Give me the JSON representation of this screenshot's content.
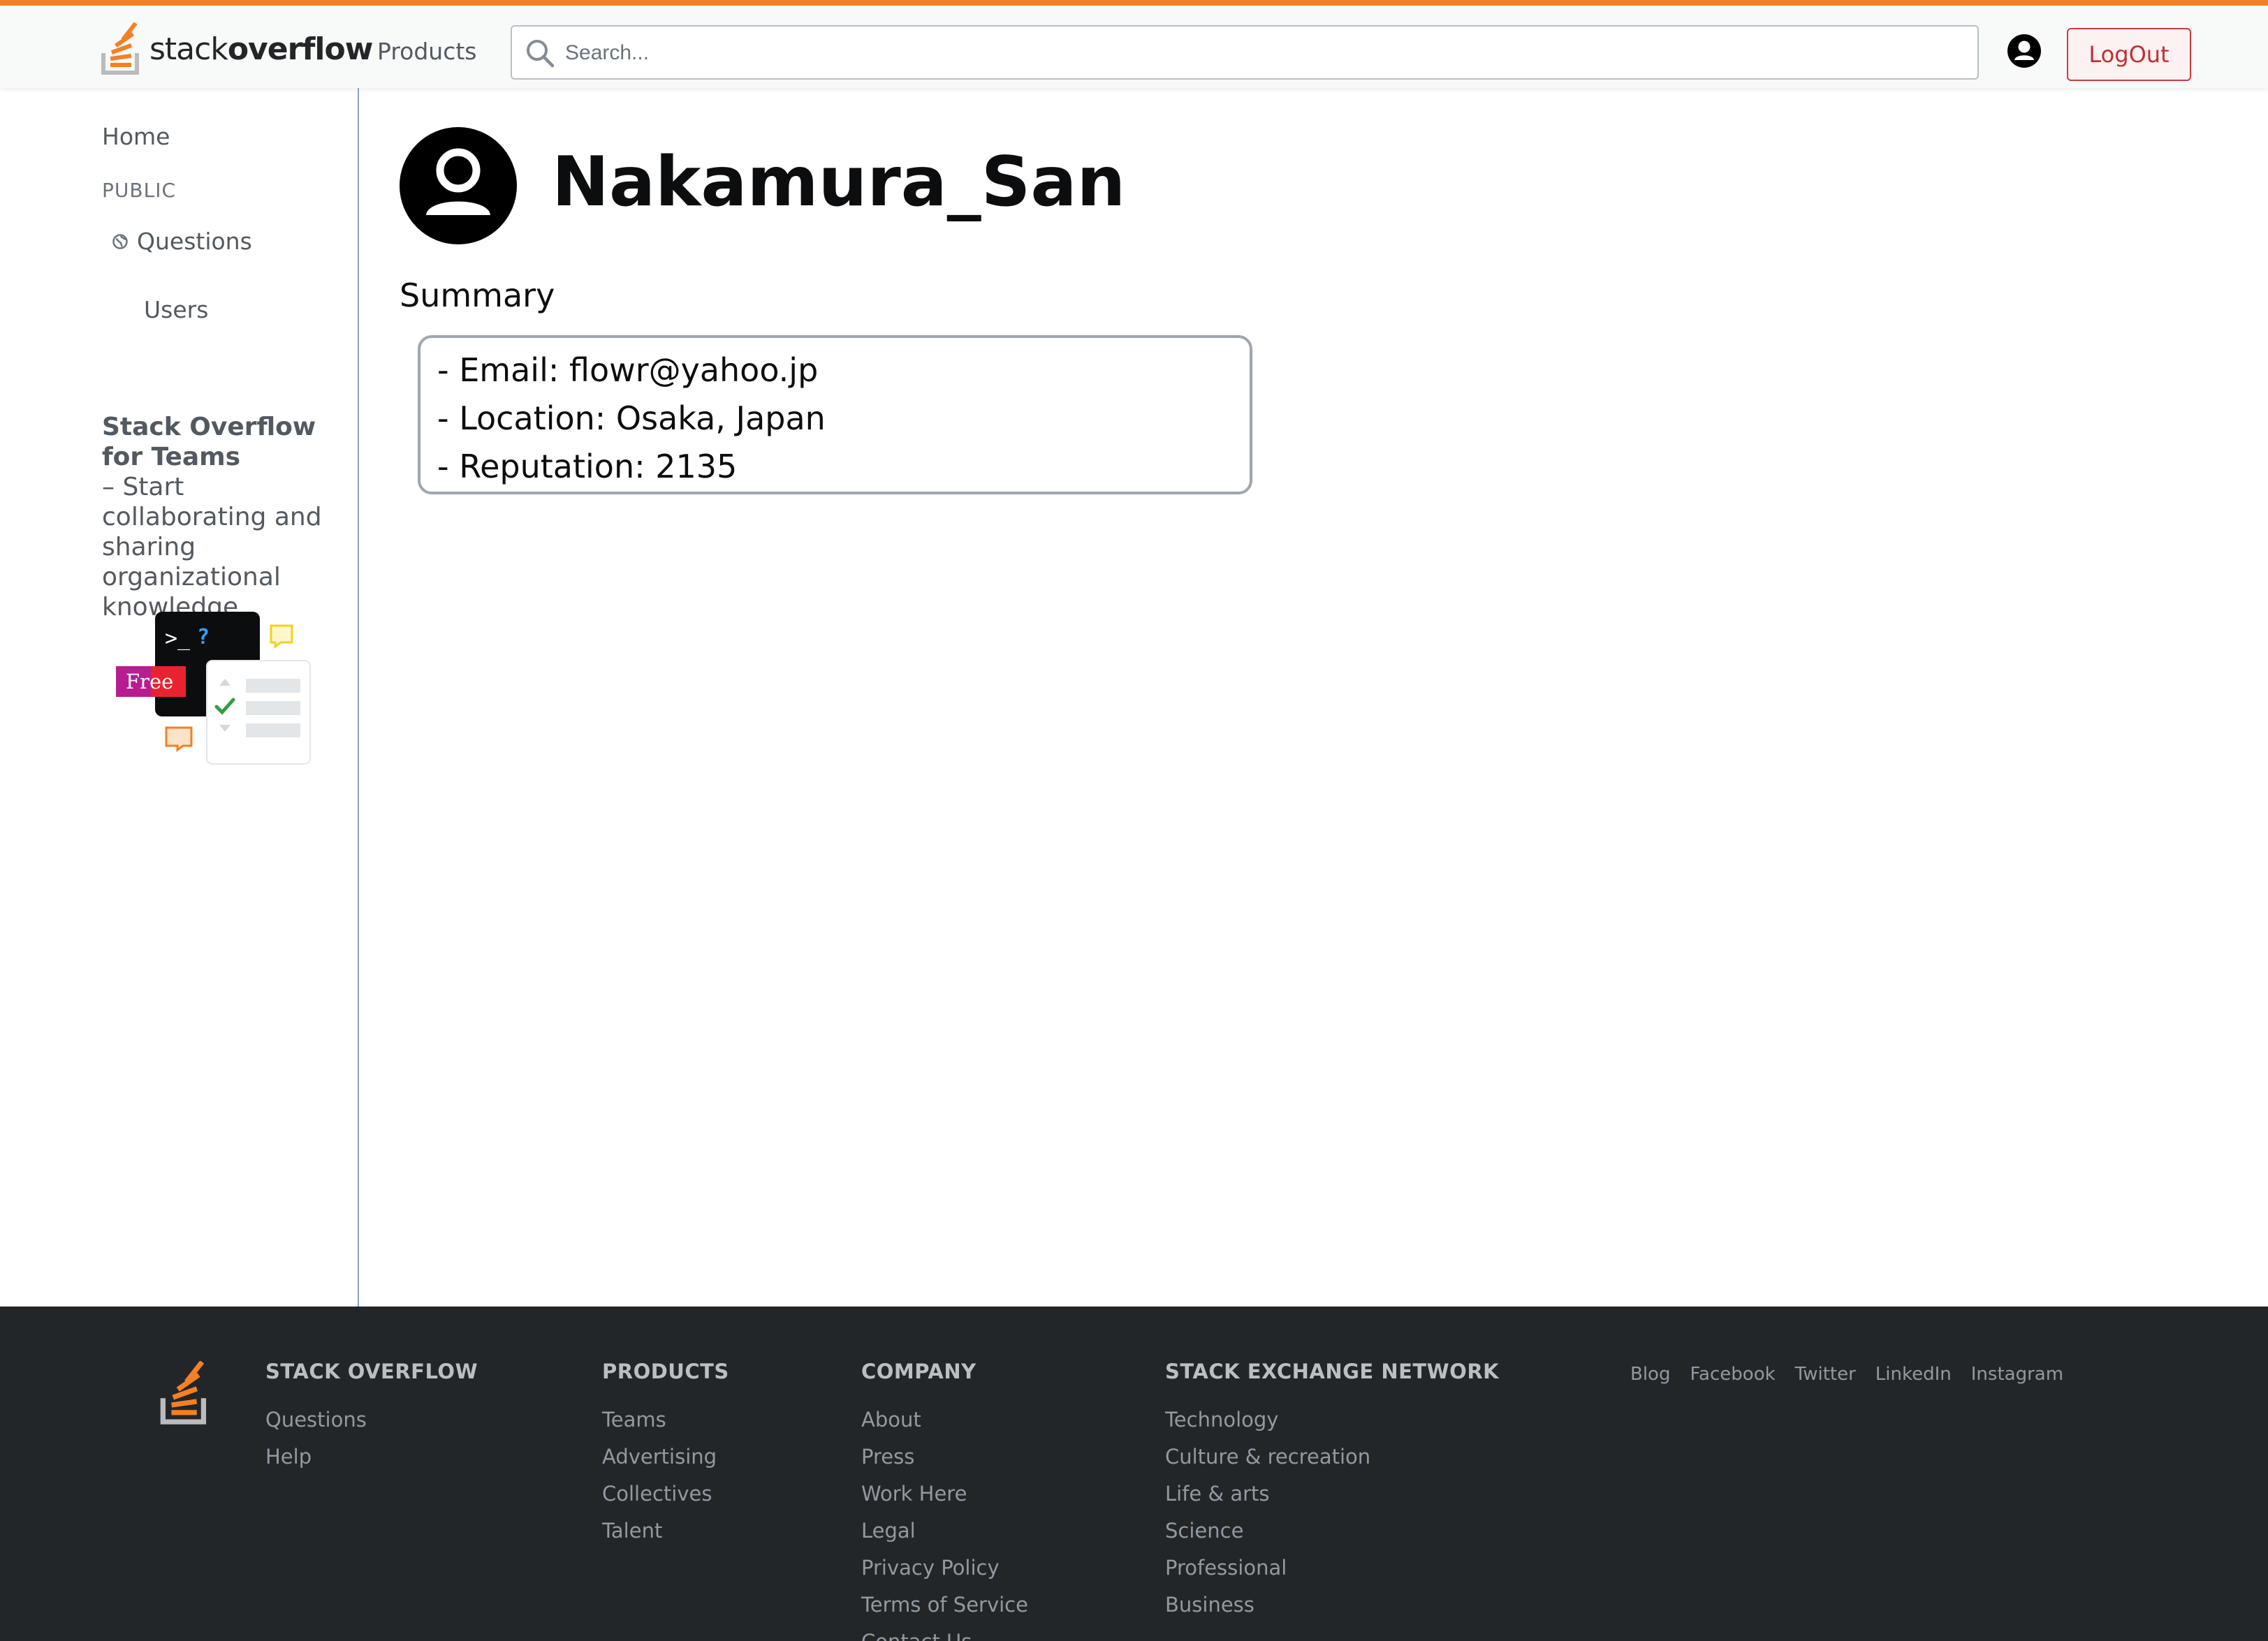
{
  "header": {
    "logo_text_light": "stack",
    "logo_text_bold": "overflow",
    "products_label": "Products",
    "search_placeholder": "Search...",
    "logout_label": "LogOut"
  },
  "sidebar": {
    "home": "Home",
    "public_label": "PUBLIC",
    "questions": "Questions",
    "users": "Users",
    "teams_title": "Stack Overflow for Teams",
    "teams_text": "– Start collaborating and sharing organizational knowledge.",
    "art": {
      "prompt_text": ">_",
      "prompt_q": "?",
      "free_badge": "Free"
    }
  },
  "profile": {
    "username": "Nakamura_San",
    "summary_heading": "Summary",
    "summary_lines": [
      "- Email: flowr@yahoo.jp",
      "- Location: Osaka, Japan",
      "- Reputation: 2135"
    ]
  },
  "footer": {
    "columns": [
      {
        "title": "STACK OVERFLOW",
        "links": [
          "Questions",
          "Help"
        ]
      },
      {
        "title": "PRODUCTS",
        "links": [
          "Teams",
          "Advertising",
          "Collectives",
          "Talent"
        ]
      },
      {
        "title": "COMPANY",
        "links": [
          "About",
          "Press",
          "Work Here",
          "Legal",
          "Privacy Policy",
          "Terms of Service",
          "Contact Us"
        ]
      },
      {
        "title": "STACK EXCHANGE NETWORK",
        "links": [
          "Technology",
          "Culture & recreation",
          "Life & arts",
          "Science",
          "Professional",
          "Business"
        ]
      }
    ],
    "social": [
      "Blog",
      "Facebook",
      "Twitter",
      "LinkedIn",
      "Instagram"
    ]
  },
  "colors": {
    "accent": "#f48024",
    "logout_border": "#d0393e",
    "footer_bg": "#232629"
  }
}
